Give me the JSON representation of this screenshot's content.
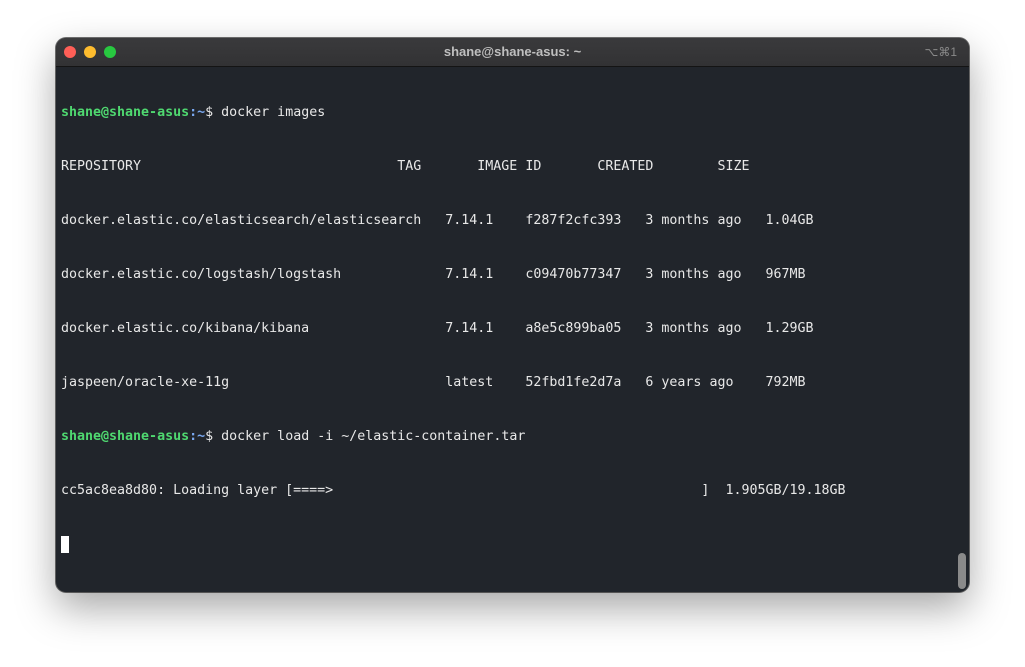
{
  "window": {
    "title": "shane@shane-asus: ~",
    "shortcut": "⌥⌘1"
  },
  "terminal": {
    "prompt_user": "shane@shane-asus",
    "prompt_sep": ":",
    "prompt_path": "~",
    "prompt_symbol": "$",
    "command1": " docker images",
    "table_header": "REPOSITORY                                TAG       IMAGE ID       CREATED        SIZE",
    "rows": [
      "docker.elastic.co/elasticsearch/elasticsearch   7.14.1    f287f2cfc393   3 months ago   1.04GB",
      "docker.elastic.co/logstash/logstash             7.14.1    c09470b77347   3 months ago   967MB",
      "docker.elastic.co/kibana/kibana                 7.14.1    a8e5c899ba05   3 months ago   1.29GB",
      "jaspeen/oracle-xe-11g                           latest    52fbd1fe2d7a   6 years ago    792MB"
    ],
    "command2": " docker load -i ~/elastic-container.tar",
    "progress_line": "cc5ac8ea8d80: Loading layer [====>                                              ]  1.905GB/19.18GB"
  },
  "colors": {
    "background": "#21252b",
    "prompt_user": "#4fd870",
    "prompt_path": "#7aa8f0",
    "text": "#e8e8e8"
  }
}
